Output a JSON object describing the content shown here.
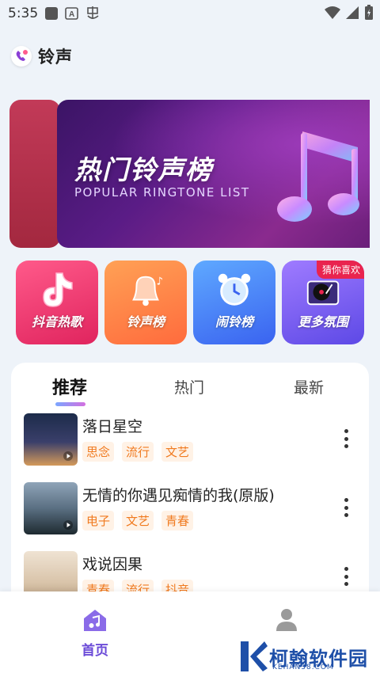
{
  "status_bar": {
    "time": "5:35"
  },
  "app": {
    "title": "铃声"
  },
  "banner": {
    "title": "热门铃声榜",
    "subtitle": "POPULAR RINGTONE LIST"
  },
  "categories": [
    {
      "label": "抖音热歌",
      "icon": "tiktok-icon"
    },
    {
      "label": "铃声榜",
      "icon": "bell-icon"
    },
    {
      "label": "闹铃榜",
      "icon": "alarm-clock-icon"
    },
    {
      "label": "更多氛围",
      "icon": "record-player-icon",
      "badge": "猜你喜欢"
    }
  ],
  "tabs": [
    {
      "label": "推荐",
      "active": true
    },
    {
      "label": "热门",
      "active": false
    },
    {
      "label": "最新",
      "active": false
    }
  ],
  "songs": [
    {
      "title": "落日星空",
      "tags": [
        "思念",
        "流行",
        "文艺"
      ]
    },
    {
      "title": "无情的你遇见痴情的我(原版)",
      "tags": [
        "电子",
        "文艺",
        "青春"
      ]
    },
    {
      "title": "戏说因果",
      "tags": [
        "青春",
        "流行",
        "抖音"
      ]
    }
  ],
  "bottom_nav": [
    {
      "label": "首页",
      "icon": "home-music-icon",
      "active": true
    },
    {
      "label": "",
      "icon": "user-icon",
      "active": false
    }
  ],
  "watermark": {
    "text": "柯翰软件园",
    "sub": "KEHAN38.COM"
  },
  "colors": {
    "accent": "#6b4bd8",
    "tag_text": "#f07a1f",
    "tag_bg": "#fff2e6"
  }
}
